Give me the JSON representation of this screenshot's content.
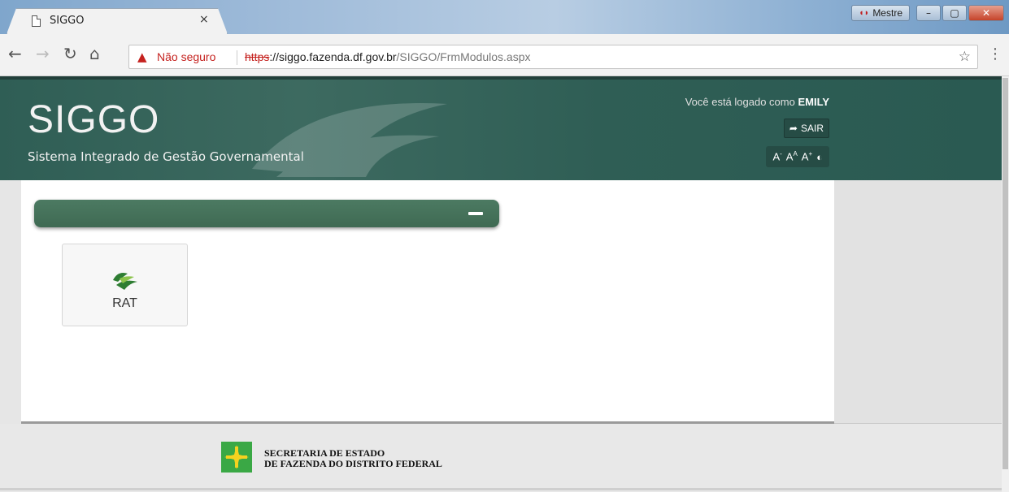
{
  "browser": {
    "tab_title": "SIGGO",
    "tab_close": "×",
    "profile_name": "Mestre",
    "security_warning": "Não seguro",
    "url_scheme": "https",
    "url_host": "://siggo.fazenda.df.gov.br",
    "url_path": "/SIGGO/FrmModulos.aspx",
    "minimize": "–",
    "restore": "▢",
    "close": "✕"
  },
  "header": {
    "logo": "SIGGO",
    "subtitle": "Sistema Integrado de Gestão Governamental",
    "logged_prefix": "Você está logado como",
    "user": "EMILY",
    "logout_label": "SAIR",
    "font_decrease": "A",
    "font_default": "A",
    "font_increase": "A"
  },
  "modules": [
    {
      "label": "RAT"
    }
  ],
  "footer": {
    "line1": "SECRETARIA DE ESTADO",
    "line2": "DE FAZENDA DO DISTRITO FEDERAL"
  },
  "colors": {
    "header_bg": "#2f5e55",
    "panel_bar": "#4c7a62",
    "warning": "#c5221f"
  }
}
